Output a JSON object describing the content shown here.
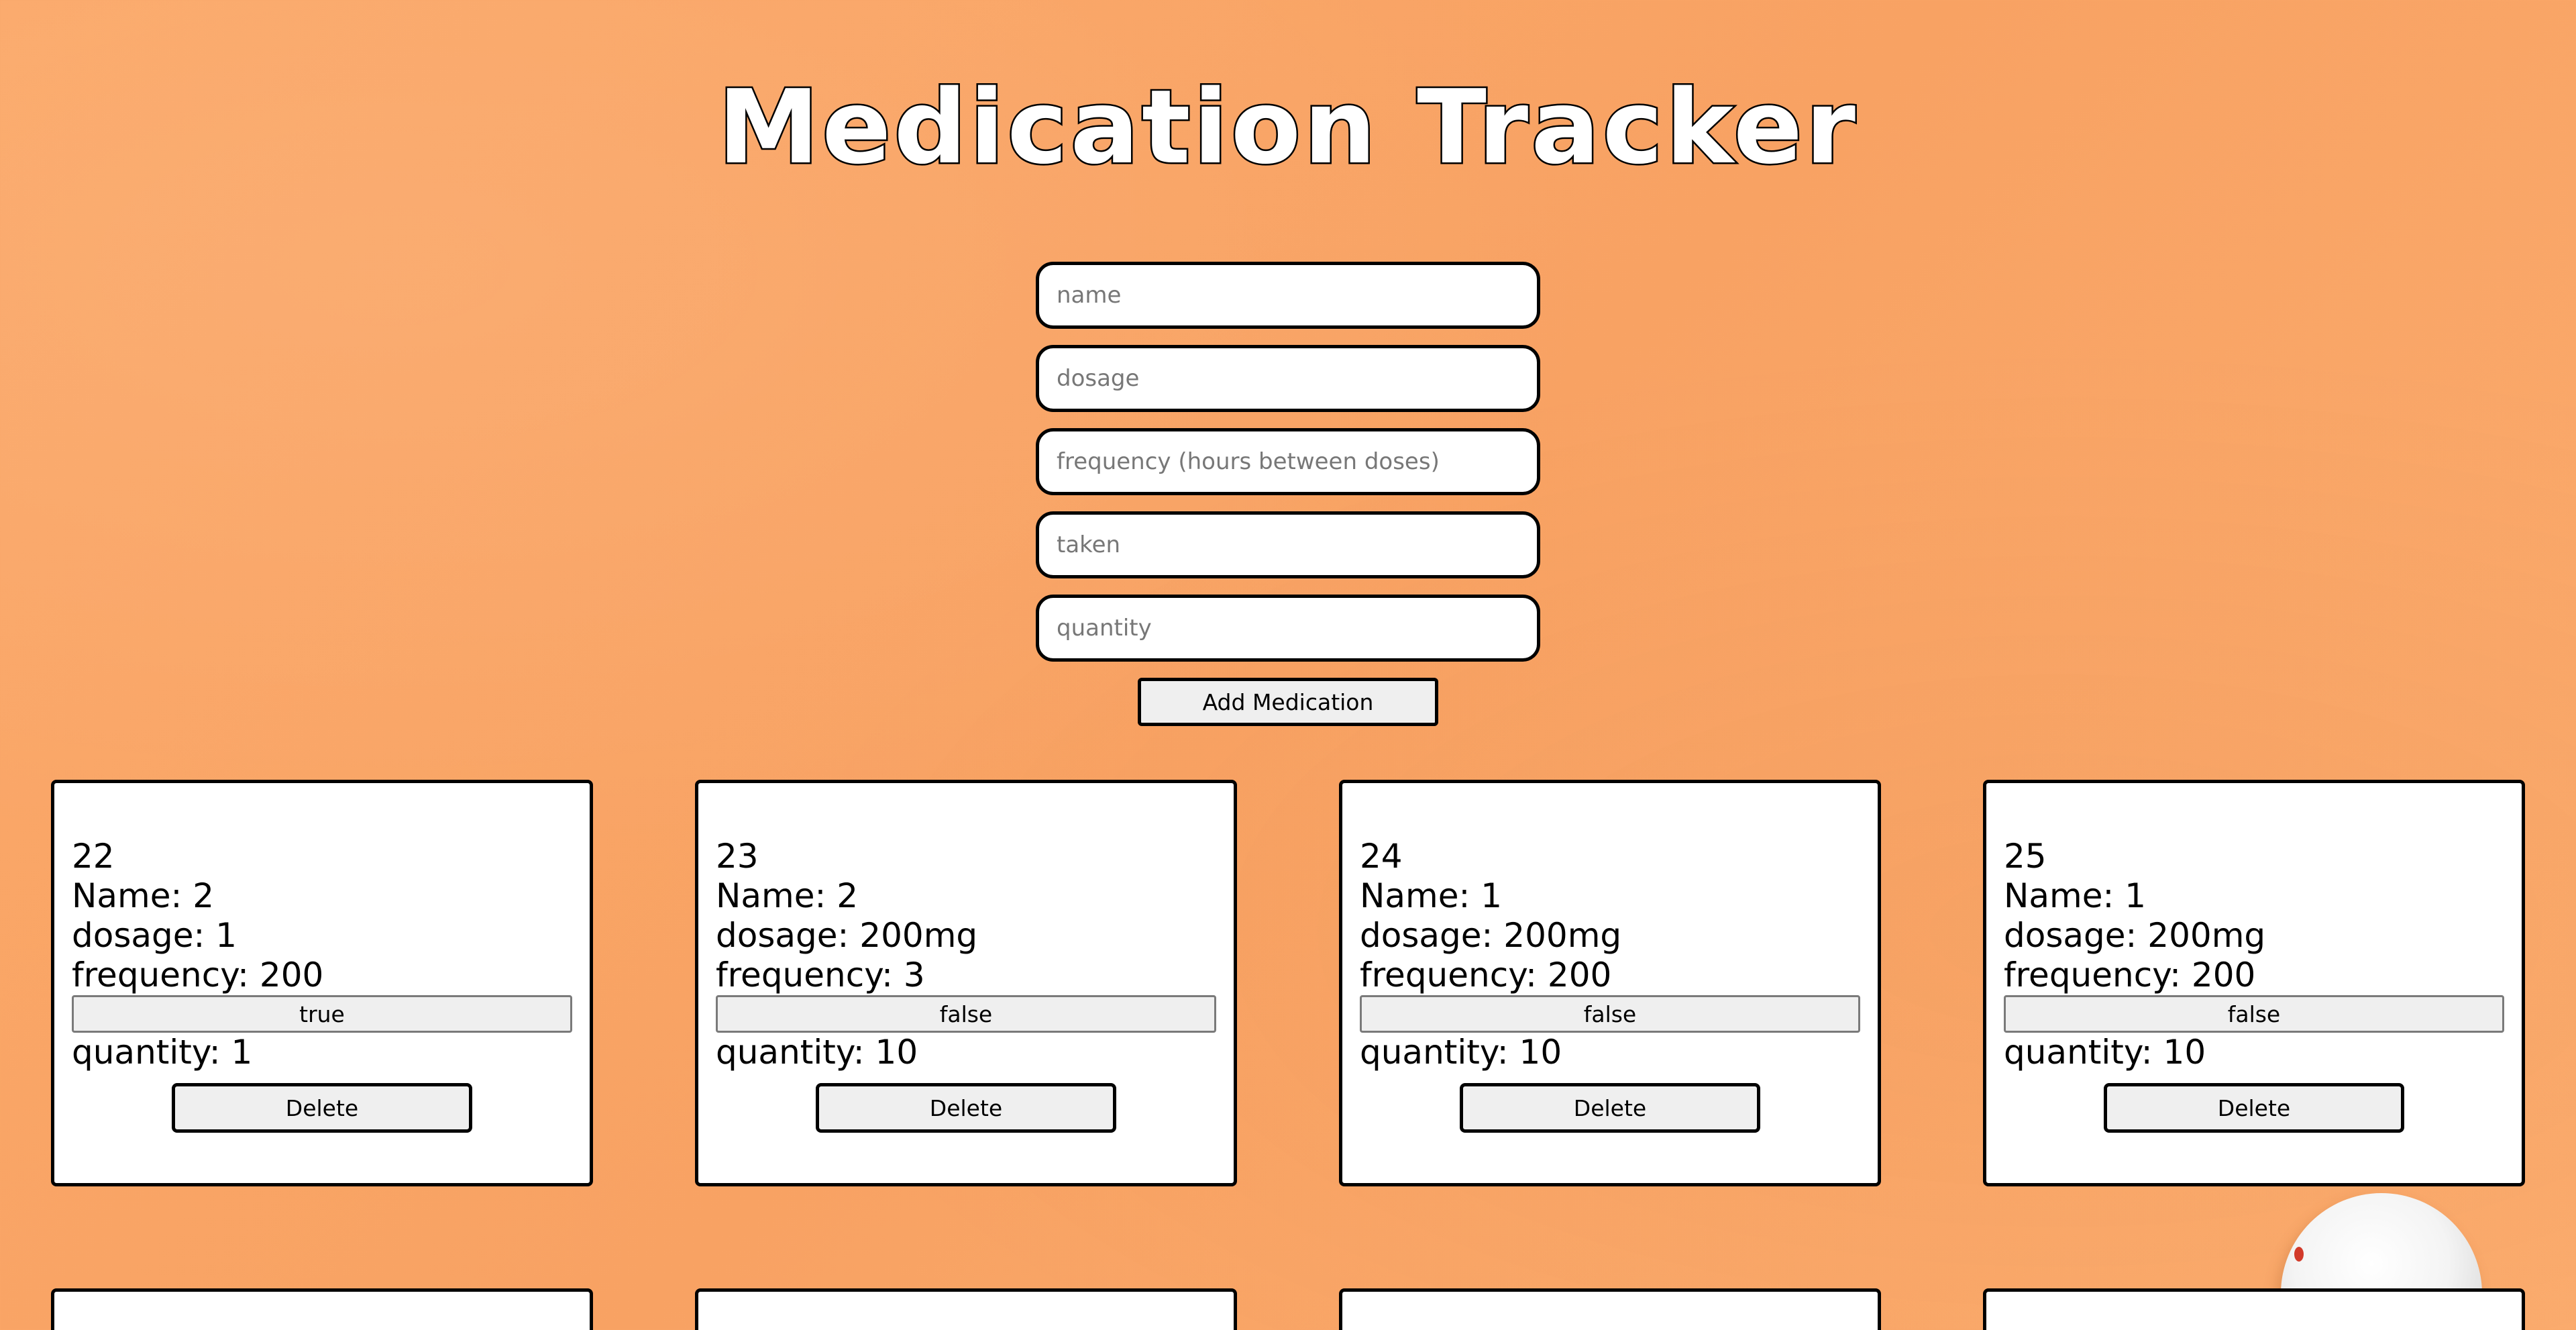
{
  "page": {
    "title": "Medication Tracker"
  },
  "form": {
    "name_placeholder": "name",
    "dosage_placeholder": "dosage",
    "frequency_placeholder": "frequency (hours between doses)",
    "taken_placeholder": "taken",
    "quantity_placeholder": "quantity",
    "add_label": "Add Medication"
  },
  "medications": [
    {
      "id": "22",
      "name": "Name: 2",
      "dosage": "dosage: 1",
      "frequency": "frequency: 200",
      "taken": "true",
      "quantity": "quantity: 1",
      "delete_label": "Delete"
    },
    {
      "id": "23",
      "name": "Name: 2",
      "dosage": "dosage: 200mg",
      "frequency": "frequency: 3",
      "taken": "false",
      "quantity": "quantity: 10",
      "delete_label": "Delete"
    },
    {
      "id": "24",
      "name": "Name: 1",
      "dosage": "dosage: 200mg",
      "frequency": "frequency: 200",
      "taken": "false",
      "quantity": "quantity: 10",
      "delete_label": "Delete"
    },
    {
      "id": "25",
      "name": "Name: 1",
      "dosage": "dosage: 200mg",
      "frequency": "frequency: 200",
      "taken": "false",
      "quantity": "quantity: 10",
      "delete_label": "Delete"
    }
  ],
  "colors": {
    "background": "#f9a868",
    "card": "#ffffff",
    "border": "#000000",
    "button": "#efefef"
  }
}
